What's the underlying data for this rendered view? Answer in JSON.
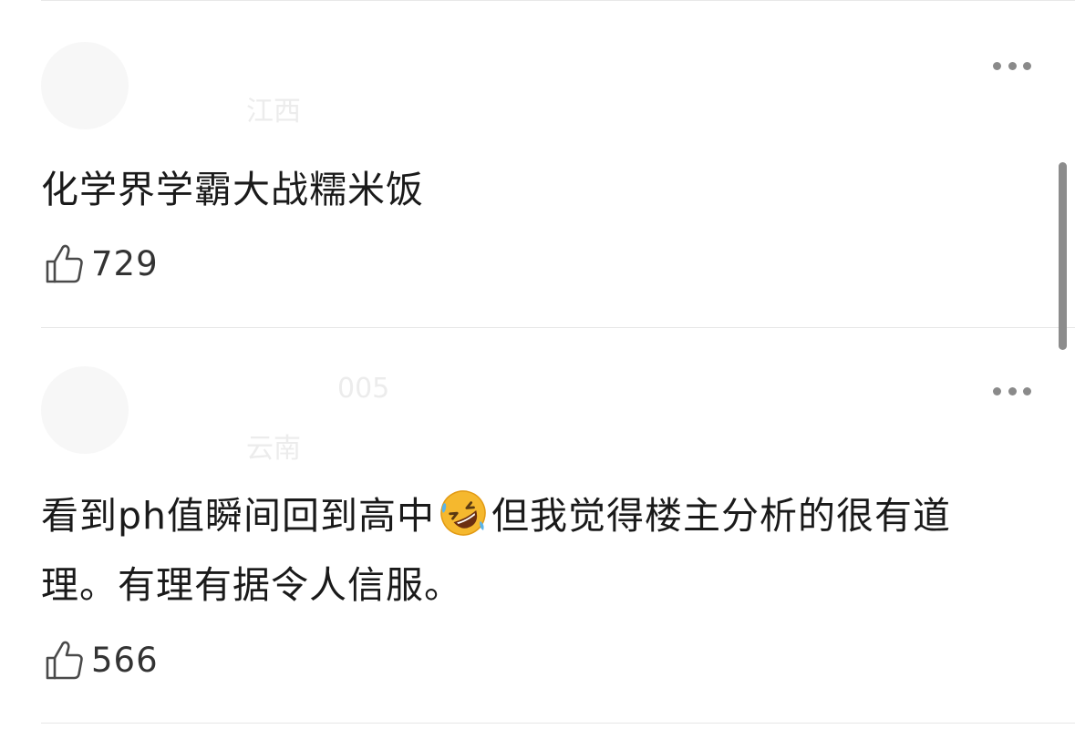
{
  "comments": [
    {
      "location": "江西",
      "text": "化学界学霸大战糯米饭",
      "likes": "729"
    },
    {
      "username_partial": "005",
      "location": "云南",
      "text_before_emoji": "看到ph值瞬间回到高中",
      "emoji": "rolling-on-floor-laughing",
      "text_after_emoji": "但我觉得楼主分析的很有道理。有理有据令人信服。",
      "likes": "566"
    }
  ],
  "icons": {
    "more": "more-horizontal-icon",
    "like": "thumbs-up-icon"
  },
  "colors": {
    "text": "#1a1a1a",
    "muted": "#8a8a8a",
    "divider": "#e6e6e6",
    "emoji_face": "#f5b82e"
  }
}
